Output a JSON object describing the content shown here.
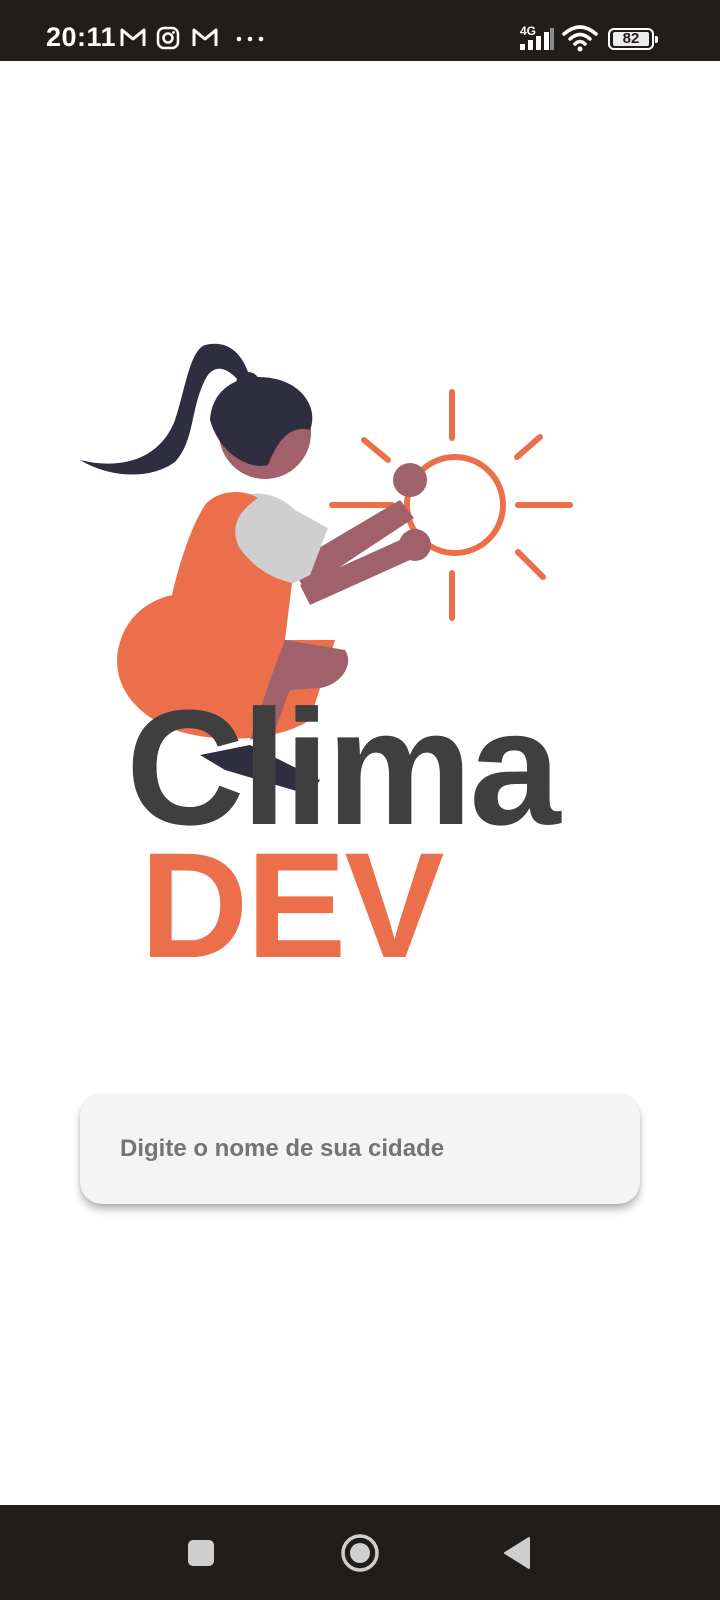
{
  "status_bar": {
    "time": "20:11",
    "notification_icons": [
      "gmail-icon",
      "instagram-icon",
      "gmail-icon",
      "more-dots-icon"
    ],
    "network": "4G",
    "battery": "82"
  },
  "app": {
    "brand_line1": "Clima",
    "brand_line2": "DEV",
    "colors": {
      "accent": "#ec6f4b",
      "dark_text": "#3f3f3f",
      "skin": "#a0616a",
      "hair": "#2f2e41"
    }
  },
  "search": {
    "placeholder": "Digite o nome de sua cidade",
    "value": ""
  },
  "nav_bar": {
    "buttons": [
      "recents-square-icon",
      "home-circle-icon",
      "back-triangle-icon"
    ]
  }
}
